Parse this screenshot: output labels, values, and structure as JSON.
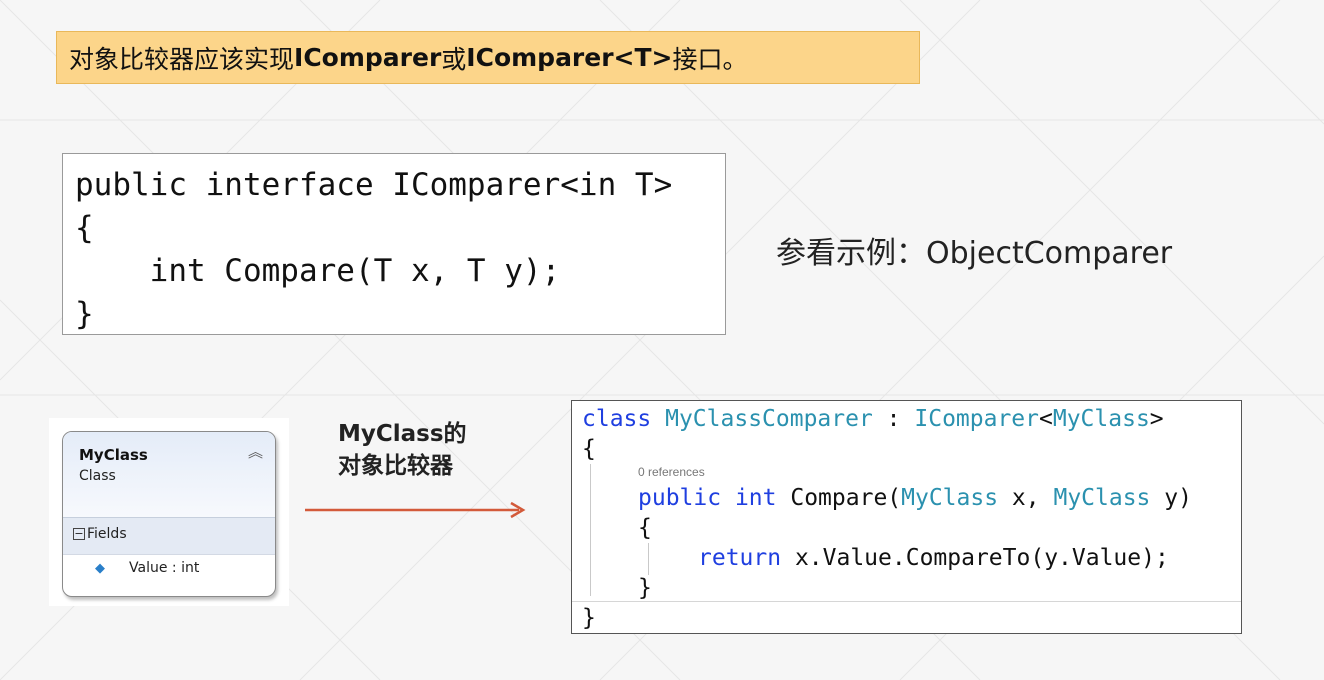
{
  "title": {
    "part1": "对象比较器应该实现",
    "iface1": "IComparer",
    "part2": "或",
    "iface2": "IComparer<T>",
    "part3": "接口。"
  },
  "interface_code": {
    "line1": "public interface IComparer<in T>",
    "line2": "{",
    "line3": "    int Compare(T x, T y);",
    "line4": "}"
  },
  "see_example": {
    "label": "参看示例：",
    "name": "ObjectComparer"
  },
  "uml_class": {
    "name": "MyClass",
    "kind": "Class",
    "collapse_glyph": "≈",
    "fields_header": "Fields",
    "fields": [
      {
        "text": "Value : int"
      }
    ]
  },
  "arrow_label": {
    "line1_en": "MyClass",
    "line1_cn": "的",
    "line2": "对象比较器"
  },
  "code_sample": {
    "class_kw": "class",
    "class_name": "MyClassComparer",
    "colon": " : ",
    "iface": "IComparer",
    "lt": "<",
    "generic_arg": "MyClass",
    "gt": ">",
    "open_brace": "{",
    "references": "0 references",
    "public_kw": "public",
    "int_kw": "int",
    "method": "Compare(",
    "param_type1": "MyClass",
    "param1": " x, ",
    "param_type2": "MyClass",
    "param2": " y)",
    "method_open": "{",
    "return_kw": "return",
    "return_expr": " x.Value.CompareTo(y.Value);",
    "method_close": "}",
    "close_brace": "}"
  },
  "colors": {
    "title_bg": "#fcd58a",
    "keyword": "#1f3fe0",
    "type": "#2b91af",
    "arrow": "#d35a3a"
  }
}
